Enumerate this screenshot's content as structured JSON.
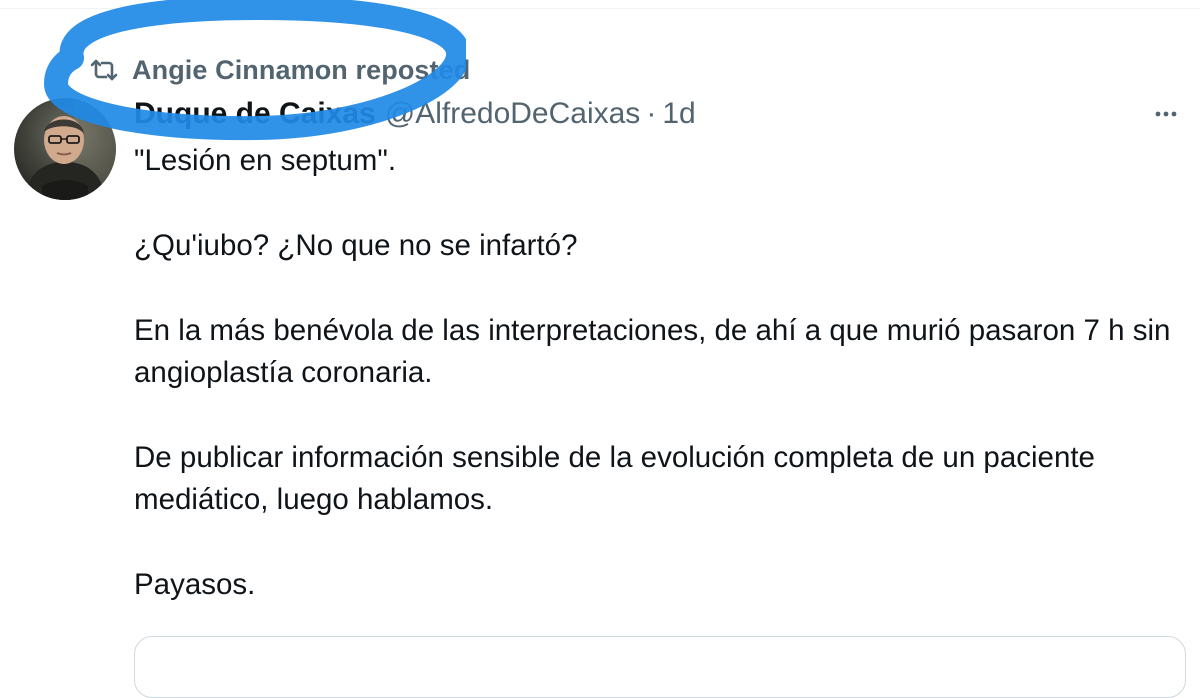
{
  "repost": {
    "icon": "repost-icon",
    "text": "Angie Cinnamon reposted"
  },
  "tweet": {
    "author": {
      "display_name": "Duque de Caixas",
      "handle": "@AlfredoDeCaixas",
      "avatar_icon": "avatar-photo"
    },
    "separator": "·",
    "timestamp": "1d",
    "paragraphs": [
      "\"Lesión en septum\".",
      "¿Qu'iubo? ¿No que no se infartó?",
      "En la más benévola de las interpretaciones, de ahí a que murió pasaron 7 h sin angioplastía coronaria.",
      "De publicar información sensible de la evolución completa de un paciente mediático, luego hablamos.",
      "Payasos."
    ],
    "more_icon": "more-horizontal-icon"
  },
  "colors": {
    "text_primary": "#0f1419",
    "text_secondary": "#536471",
    "highlight_ring": "#1f8ae6",
    "divider": "#eff3f4"
  }
}
